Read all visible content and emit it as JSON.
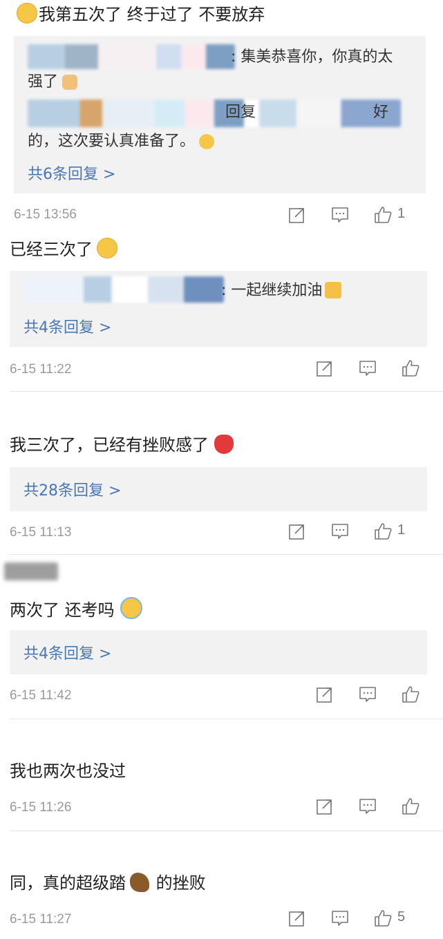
{
  "comments": [
    {
      "text": "我第五次了 终于过了 不要放弃",
      "emoji": "sweat-smile",
      "replies": [
        {
          "prefix": ": ",
          "text": "集美恭喜你，你真的太",
          "text2": "强了",
          "emoji": "thumbs-up"
        },
        {
          "prefix": "回复",
          "text": "好",
          "text2": "的，这次要认真准备了。",
          "emoji": "kiss"
        }
      ],
      "more": "共6条回复 >",
      "time": "6-15 13:56",
      "likes": "1"
    },
    {
      "text": "已经三次了",
      "emoji": "eye-roll",
      "replies": [
        {
          "prefix": ": ",
          "text": "一起继续加油",
          "emoji": "muscle"
        }
      ],
      "more": "共4条回复 >",
      "time": "6-15 11:22",
      "likes": ""
    },
    {
      "text": "我三次了，已经有挫败感了",
      "emoji": "broken-heart",
      "more": "共28条回复 >",
      "time": "6-15 11:13",
      "likes": "1"
    },
    {
      "text": "两次了 还考吗",
      "emoji": "crying",
      "more": "共4条回复 >",
      "time": "6-15 11:42",
      "likes": ""
    },
    {
      "text": "我也两次也没过",
      "time": "6-15 11:26",
      "likes": ""
    },
    {
      "text": "同，真的超级踏",
      "text_after": " 的挫败",
      "emoji": "horse",
      "time": "6-15 11:27",
      "likes": "5"
    }
  ],
  "icons": {
    "share": "share-icon",
    "comment": "comment-icon",
    "like": "like-icon"
  },
  "colors": {
    "link": "#4a77b4",
    "timestamp": "#9a9a9a",
    "reply_bg": "#f2f2f2",
    "heart": "#e3393c",
    "emoji_yellow": "#f6c646"
  }
}
